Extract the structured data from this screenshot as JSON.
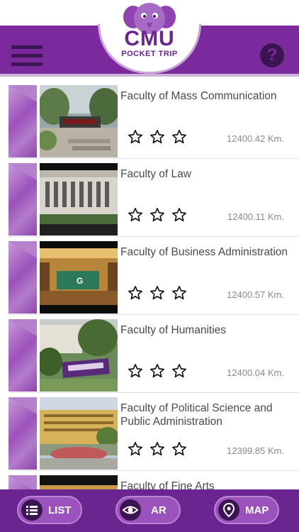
{
  "app": {
    "logo_title": "CMU",
    "logo_subtitle": "POCKET TRIP",
    "help_label": "?"
  },
  "colors": {
    "brand_purple": "#7a2a9c",
    "dark_purple": "#3b1452",
    "bottom_bar": "#6a2590",
    "accent_light": "#c79ad8"
  },
  "list": {
    "items": [
      {
        "title": "Faculty of Mass Communication",
        "distance": "12400.42 Km.",
        "rating": 0,
        "max_rating": 3,
        "image": "building-garden-photo"
      },
      {
        "title": "Faculty of Law",
        "distance": "12400.11 Km.",
        "rating": 0,
        "max_rating": 3,
        "image": "law-building-photo"
      },
      {
        "title": "Faculty of Business Administration",
        "distance": "12400.57 Km.",
        "rating": 0,
        "max_rating": 3,
        "image": "business-interior-photo"
      },
      {
        "title": "Faculty of Humanities",
        "distance": "12400.04 Km.",
        "rating": 0,
        "max_rating": 3,
        "image": "humanities-sign-photo"
      },
      {
        "title": "Faculty of Political Science and Public Administration",
        "distance": "12399.85 Km.",
        "rating": 0,
        "max_rating": 3,
        "image": "political-science-building-photo"
      },
      {
        "title": "Faculty of Fine Arts",
        "distance": "",
        "rating": 0,
        "max_rating": 3,
        "image": "fine-arts-photo"
      }
    ]
  },
  "bottom_nav": {
    "list_label": "LIST",
    "ar_label": "AR",
    "map_label": "MAP",
    "list_icon": "list-icon",
    "ar_icon": "eye-icon",
    "map_icon": "map-pin-icon"
  }
}
